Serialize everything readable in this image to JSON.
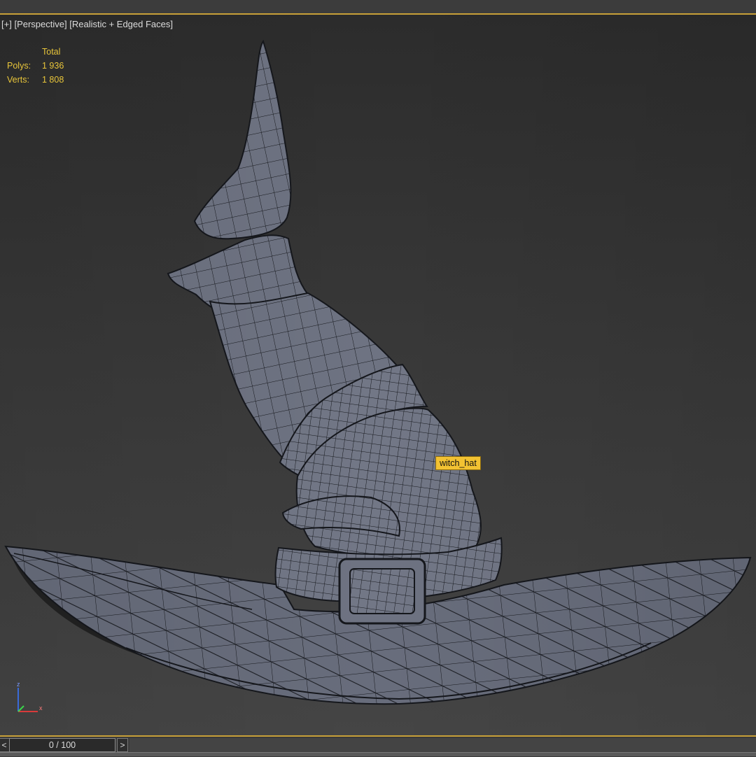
{
  "viewport": {
    "label_plus": "[+]",
    "label_view": "[Perspective]",
    "label_shading": "[Realistic + Edged Faces]"
  },
  "stats": {
    "header": "Total",
    "polys_label": "Polys:",
    "polys_value": "1 936",
    "verts_label": "Verts:",
    "verts_value": "1 808"
  },
  "object": {
    "name": "witch_hat"
  },
  "axis_gizmo": {
    "z": "z",
    "x": "x"
  },
  "timeline": {
    "prev": "<",
    "frame": "0 / 100",
    "next": ">"
  },
  "colors": {
    "mesh_fill": "#6e7382",
    "wire": "#111111",
    "accent": "#c8a038",
    "stats_text": "#e8c53a",
    "tooltip_bg": "#f2c232"
  }
}
